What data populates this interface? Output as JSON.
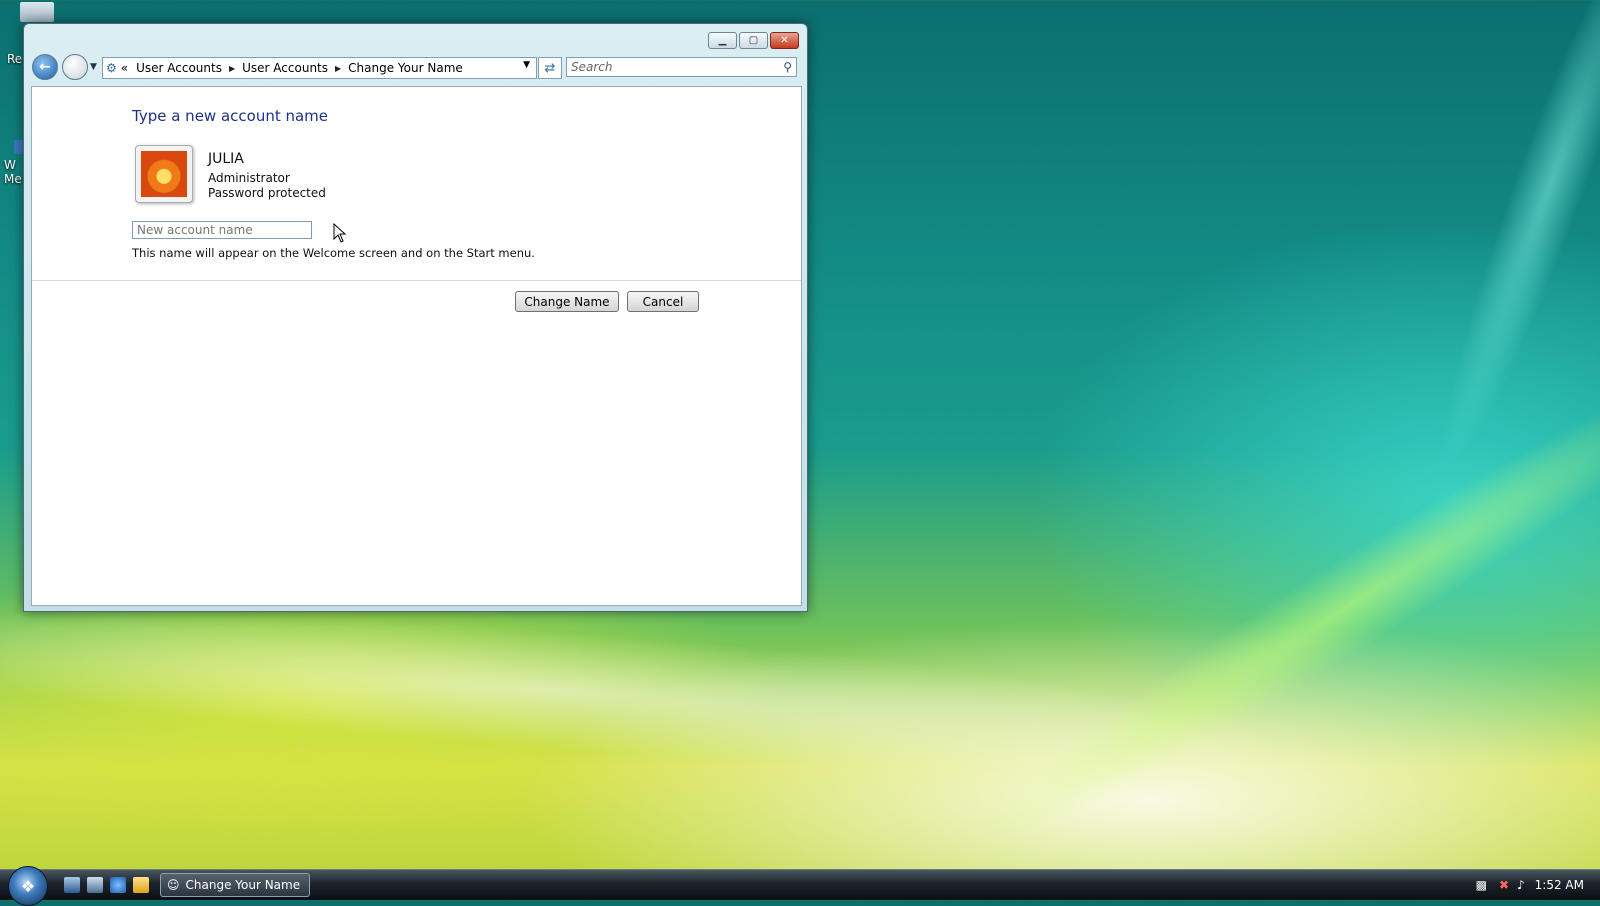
{
  "desktop": {
    "icons": [
      {
        "label": "Re"
      },
      {
        "label": "W\nMe"
      }
    ]
  },
  "window": {
    "buttons": {
      "minimize": "▁",
      "maximize": "▢",
      "close": "✕"
    },
    "address": {
      "overflow": "«",
      "segments": [
        "User Accounts",
        "User Accounts",
        "Change Your Name"
      ]
    },
    "search_placeholder": "Search"
  },
  "content": {
    "heading": "Type a new account name",
    "account": {
      "name": "JULIA",
      "role": "Administrator",
      "status": "Password protected"
    },
    "input_placeholder": "New account name",
    "hint": "This name will appear on the Welcome screen and on the Start menu.",
    "buttons": {
      "change": "Change Name",
      "cancel": "Cancel"
    }
  },
  "taskbar": {
    "task_label": "Change Your Name",
    "clock": "1:52 AM"
  },
  "colors": {
    "heading": "#1e3287",
    "taskbar": "#1c232a"
  }
}
